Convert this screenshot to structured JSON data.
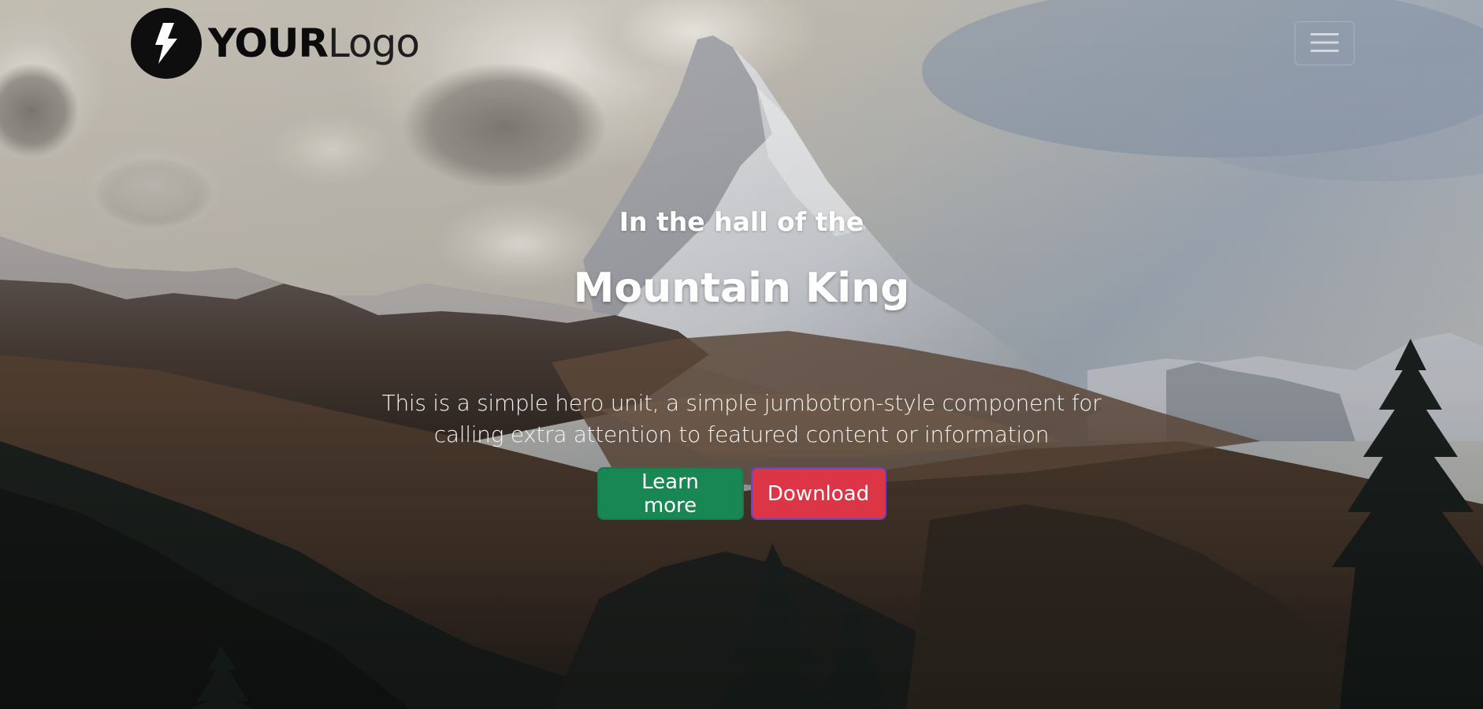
{
  "navbar": {
    "brand": {
      "strong": "YOUR",
      "light": "Logo",
      "icon": "lightning-bolt-icon"
    },
    "toggler": {
      "icon": "hamburger-menu-icon",
      "aria_label": "Toggle navigation"
    }
  },
  "hero": {
    "kicker": "In the hall of the",
    "title": "Mountain King",
    "lead": "This is a simple hero unit, a simple jumbotron-style component for calling extra attention to featured content or information",
    "actions": {
      "learn_more": "Learn more",
      "download": "Download"
    },
    "background_image": "snow-capped-mountain-peak-photo"
  },
  "colors": {
    "success": "#198754",
    "danger": "#dc3545",
    "hero_text": "#ffffff",
    "logo": "#0e0e0e"
  }
}
